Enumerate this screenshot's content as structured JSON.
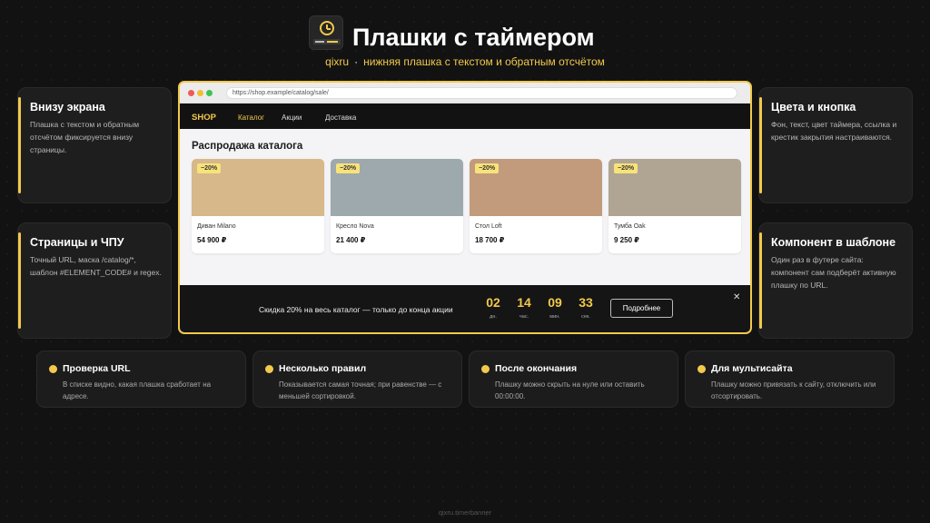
{
  "header": {
    "title": "Плашки с таймером",
    "brand": "qixru",
    "separator": "·",
    "tagline": "нижняя плашка с текстом и обратным отсчётом"
  },
  "left_cards": [
    {
      "title": "Внизу экрана",
      "text": "Плашка с текстом и обратным отсчётом фиксируется внизу страницы."
    },
    {
      "title": "Страницы и ЧПУ",
      "text": "Точный URL, маска /catalog/*, шаблон #ELEMENT_CODE# и regex."
    }
  ],
  "right_cards": [
    {
      "title": "Цвета и кнопка",
      "text": "Фон, текст, цвет таймера, ссылка и крестик закрытия настраиваются."
    },
    {
      "title": "Компонент в шаблоне",
      "text": "Один раз в футере сайта: компонент сам подберёт активную плашку по URL."
    }
  ],
  "features": [
    {
      "title": "Проверка URL",
      "text": "В списке видно, какая плашка сработает на адресе."
    },
    {
      "title": "Несколько правил",
      "text": "Показывается самая точная; при равенстве — с меньшей сортировкой."
    },
    {
      "title": "После окончания",
      "text": "Плашку можно скрыть на нуле или оставить 00:00:00."
    },
    {
      "title": "Для мультисайта",
      "text": "Плашку можно привязать к сайту, отключить или отсортировать."
    }
  ],
  "browser": {
    "url": "https://shop.example/catalog/sale/",
    "nav": {
      "logo": "SHOP",
      "links": [
        "Каталог",
        "Акции",
        "Доставка"
      ],
      "active": "Каталог"
    },
    "page_title": "Распродажа каталога",
    "products": [
      {
        "badge": "−20%",
        "name": "Диван Milano",
        "price": "54 900 ₽",
        "color": "#d6b88a"
      },
      {
        "badge": "−20%",
        "name": "Кресло Nova",
        "price": "21 400 ₽",
        "color": "#9ea9ad"
      },
      {
        "badge": "−20%",
        "name": "Стол Loft",
        "price": "18 700 ₽",
        "color": "#c29b7c"
      },
      {
        "badge": "−20%",
        "name": "Тумба Oak",
        "price": "9 250 ₽",
        "color": "#b0a592"
      }
    ],
    "banner": {
      "message": "Скидка 20% на весь каталог — только до конца акции",
      "countdown": [
        {
          "value": "02",
          "unit": "дн."
        },
        {
          "value": "14",
          "unit": "час."
        },
        {
          "value": "09",
          "unit": "мин."
        },
        {
          "value": "33",
          "unit": "сек."
        }
      ],
      "button": "Подробнее",
      "close": "✕"
    }
  },
  "footer": "qixru.timerbanner",
  "colors": {
    "accent": "#f2c94c",
    "background": "#121212",
    "card": "#1e1e1e"
  }
}
